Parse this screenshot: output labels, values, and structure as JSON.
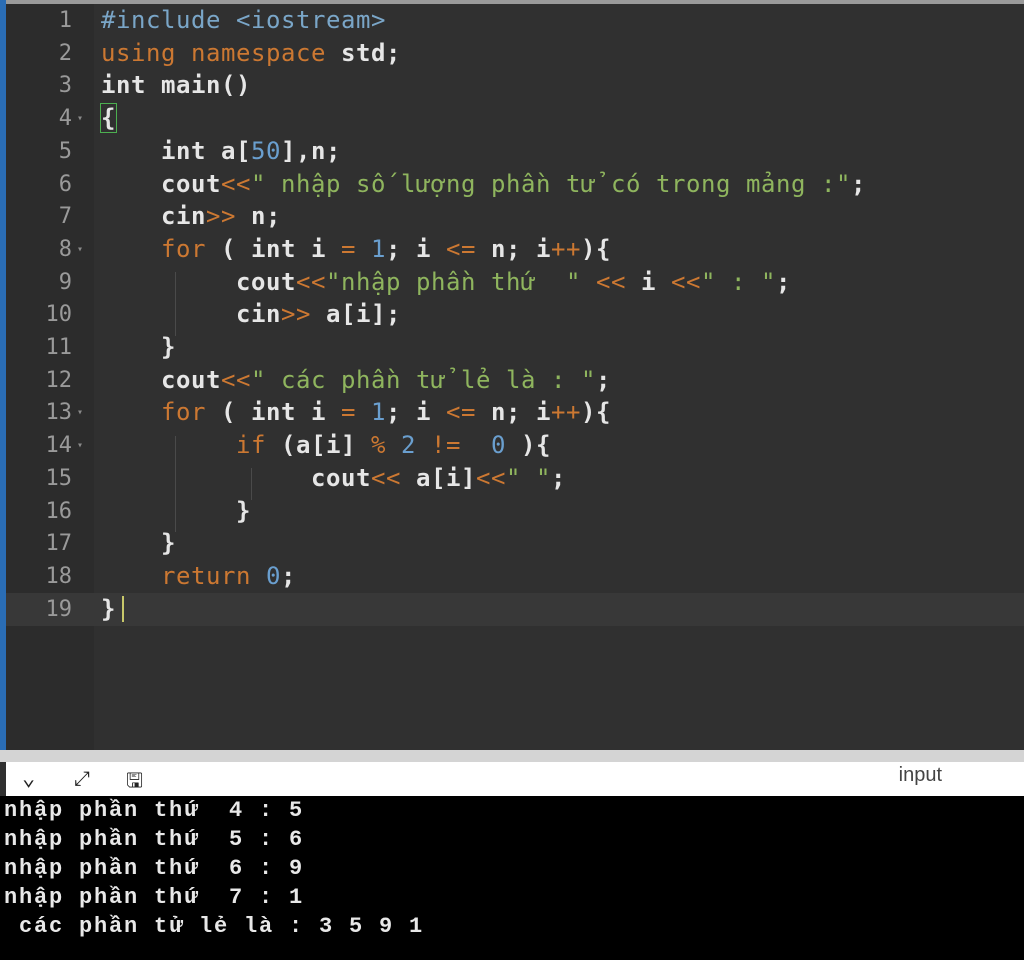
{
  "editor": {
    "lines": [
      {
        "n": "1",
        "tokens": [
          [
            "inc",
            "#include"
          ],
          [
            "plain",
            " "
          ],
          [
            "inc",
            "<iostream>"
          ]
        ]
      },
      {
        "n": "2",
        "tokens": [
          [
            "kw",
            "using"
          ],
          [
            "plain",
            " "
          ],
          [
            "kw",
            "namespace"
          ],
          [
            "plain",
            " std;"
          ]
        ]
      },
      {
        "n": "3",
        "tokens": [
          [
            "plain",
            "int main()"
          ]
        ]
      },
      {
        "n": "4",
        "fold": true,
        "tokens": [
          [
            "brace",
            "{"
          ]
        ]
      },
      {
        "n": "5",
        "tokens": [
          [
            "plain",
            "    int a["
          ],
          [
            "num",
            "50"
          ],
          [
            "plain",
            "],n;"
          ]
        ]
      },
      {
        "n": "6",
        "tokens": [
          [
            "plain",
            "    cout"
          ],
          [
            "op",
            "<<"
          ],
          [
            "str",
            "\" nhập số lượng phần tử có trong mảng :\""
          ],
          [
            "plain",
            ";"
          ]
        ]
      },
      {
        "n": "7",
        "tokens": [
          [
            "plain",
            "    cin"
          ],
          [
            "op",
            ">>"
          ],
          [
            "plain",
            " n;"
          ]
        ]
      },
      {
        "n": "8",
        "fold": true,
        "tokens": [
          [
            "plain",
            "    "
          ],
          [
            "kw",
            "for"
          ],
          [
            "plain",
            " ( int i "
          ],
          [
            "op",
            "="
          ],
          [
            "plain",
            " "
          ],
          [
            "num",
            "1"
          ],
          [
            "plain",
            "; i "
          ],
          [
            "op",
            "<="
          ],
          [
            "plain",
            " n; i"
          ],
          [
            "op",
            "++"
          ],
          [
            "plain",
            "){"
          ]
        ]
      },
      {
        "n": "9",
        "tokens": [
          [
            "plain",
            "         cout"
          ],
          [
            "op",
            "<<"
          ],
          [
            "str",
            "\"nhập phần thứ  \""
          ],
          [
            "plain",
            " "
          ],
          [
            "op",
            "<<"
          ],
          [
            "plain",
            " i "
          ],
          [
            "op",
            "<<"
          ],
          [
            "str",
            "\" : \""
          ],
          [
            "plain",
            ";"
          ]
        ]
      },
      {
        "n": "10",
        "tokens": [
          [
            "plain",
            "         cin"
          ],
          [
            "op",
            ">>"
          ],
          [
            "plain",
            " a[i];"
          ]
        ]
      },
      {
        "n": "11",
        "tokens": [
          [
            "plain",
            "    }"
          ]
        ]
      },
      {
        "n": "12",
        "tokens": [
          [
            "plain",
            "    cout"
          ],
          [
            "op",
            "<<"
          ],
          [
            "str",
            "\" các phần tử lẻ là : \""
          ],
          [
            "plain",
            ";"
          ]
        ]
      },
      {
        "n": "13",
        "fold": true,
        "tokens": [
          [
            "plain",
            "    "
          ],
          [
            "kw",
            "for"
          ],
          [
            "plain",
            " ( int i "
          ],
          [
            "op",
            "="
          ],
          [
            "plain",
            " "
          ],
          [
            "num",
            "1"
          ],
          [
            "plain",
            "; i "
          ],
          [
            "op",
            "<="
          ],
          [
            "plain",
            " n; i"
          ],
          [
            "op",
            "++"
          ],
          [
            "plain",
            "){"
          ]
        ]
      },
      {
        "n": "14",
        "fold": true,
        "tokens": [
          [
            "plain",
            "         "
          ],
          [
            "kw",
            "if"
          ],
          [
            "plain",
            " (a[i] "
          ],
          [
            "op",
            "%"
          ],
          [
            "plain",
            " "
          ],
          [
            "num",
            "2"
          ],
          [
            "plain",
            " "
          ],
          [
            "op",
            "!="
          ],
          [
            "plain",
            "  "
          ],
          [
            "num",
            "0"
          ],
          [
            "plain",
            " ){"
          ]
        ]
      },
      {
        "n": "15",
        "tokens": [
          [
            "plain",
            "              cout"
          ],
          [
            "op",
            "<<"
          ],
          [
            "plain",
            " a[i]"
          ],
          [
            "op",
            "<<"
          ],
          [
            "str",
            "\" \""
          ],
          [
            "plain",
            ";"
          ]
        ]
      },
      {
        "n": "16",
        "tokens": [
          [
            "plain",
            "         }"
          ]
        ]
      },
      {
        "n": "17",
        "tokens": [
          [
            "plain",
            "    }"
          ]
        ]
      },
      {
        "n": "18",
        "tokens": [
          [
            "plain",
            "    "
          ],
          [
            "kw",
            "return"
          ],
          [
            "plain",
            " "
          ],
          [
            "num",
            "0"
          ],
          [
            "plain",
            ";"
          ]
        ]
      },
      {
        "n": "19",
        "active": true,
        "tokens": [
          [
            "plain",
            "}"
          ]
        ]
      }
    ]
  },
  "toolbar": {
    "collapse_icon": "chevron-down-icon",
    "expand_icon": "expand-icon",
    "clear_icon": "clear-console-icon",
    "label": "input"
  },
  "terminal": {
    "lines": [
      "nhập phần thứ  4 : 5",
      "nhập phần thứ  5 : 6",
      "nhập phần thứ  6 : 9",
      "nhập phần thứ  7 : 1",
      " các phần tử lẻ là : 3 5 9 1"
    ]
  }
}
